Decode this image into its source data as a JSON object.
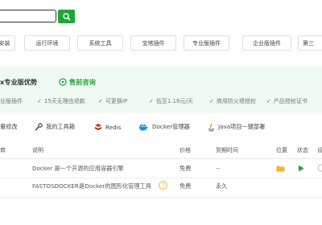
{
  "search": {
    "value": "",
    "placeholder": ""
  },
  "categories": [
    {
      "label": "安装"
    },
    {
      "label": "运行环境"
    },
    {
      "label": "系统工具"
    },
    {
      "label": "宝塔插件"
    },
    {
      "label": "专业版插件"
    },
    {
      "label": "企业版插件"
    },
    {
      "label": "第三"
    }
  ],
  "promo": {
    "title": "x专业版优势",
    "consult_label": "售前咨询",
    "features": [
      {
        "label": "业版插件"
      },
      {
        "label": "15天无理由退款"
      },
      {
        "label": "可更换IP"
      },
      {
        "label": "低至1.18元/天"
      },
      {
        "label": "商用防火墙授权"
      },
      {
        "label": "产品授权证书"
      }
    ]
  },
  "tools": [
    {
      "label": "量修改",
      "icon": ""
    },
    {
      "label": "我的工具箱",
      "icon": "wrench-icon"
    },
    {
      "label": "Redis",
      "icon": "redis-icon"
    },
    {
      "label": "Docker管理器",
      "icon": "docker-icon"
    },
    {
      "label": "Java项目一键部署",
      "icon": "java-icon"
    }
  ],
  "table": {
    "headers": {
      "name": "商",
      "desc": "说明",
      "price": "价格",
      "expire": "到期时间",
      "location": "位置",
      "status": "状态",
      "action": "设"
    },
    "rows": [
      {
        "desc": "Docker 是一个开源的应用容器引擎",
        "price": "免费",
        "expire": "--"
      },
      {
        "desc": "FASTOSDOCKER是Docker的图形化管理工具",
        "price": "免费",
        "expire": "永久"
      }
    ]
  },
  "colors": {
    "accent": "#20a53a",
    "promo_bg": "#f1f9f3"
  }
}
